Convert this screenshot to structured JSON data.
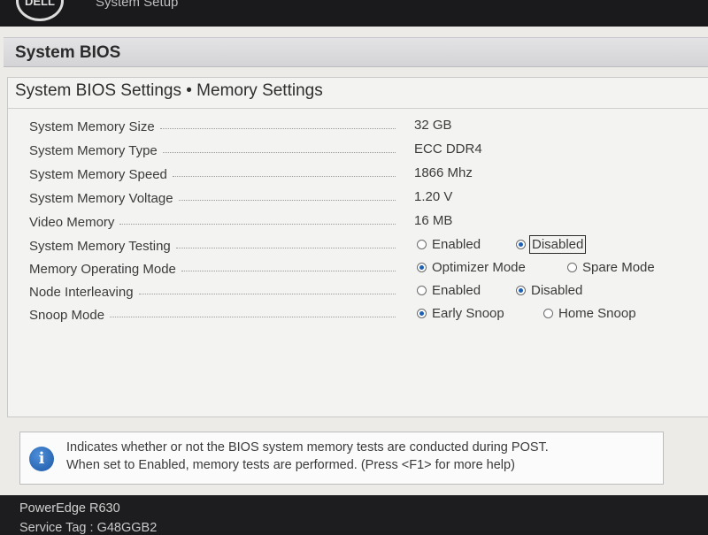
{
  "header": {
    "logo": "DELL",
    "title": "System Setup"
  },
  "main": {
    "title": "System BIOS"
  },
  "section": {
    "title": "System BIOS Settings • Memory Settings"
  },
  "info_rows": [
    {
      "label": "System Memory Size",
      "value": "32 GB"
    },
    {
      "label": "System Memory Type",
      "value": "ECC DDR4"
    },
    {
      "label": "System Memory Speed",
      "value": "1866 Mhz"
    },
    {
      "label": "System Memory Voltage",
      "value": "1.20 V"
    },
    {
      "label": "Video Memory",
      "value": "16 MB"
    }
  ],
  "option_rows": [
    {
      "label": "System Memory Testing",
      "options": [
        {
          "label": "Enabled",
          "selected": false
        },
        {
          "label": "Disabled",
          "selected": true
        }
      ]
    },
    {
      "label": "Memory Operating Mode",
      "options": [
        {
          "label": "Optimizer Mode",
          "selected": true
        },
        {
          "label": "Spare Mode",
          "selected": false
        }
      ]
    },
    {
      "label": "Node Interleaving",
      "options": [
        {
          "label": "Enabled",
          "selected": false
        },
        {
          "label": "Disabled",
          "selected": true
        }
      ]
    },
    {
      "label": "Snoop Mode",
      "options": [
        {
          "label": "Early Snoop",
          "selected": true
        },
        {
          "label": "Home Snoop",
          "selected": false
        }
      ]
    }
  ],
  "help": {
    "icon": "info-icon",
    "line1": "Indicates whether or not the BIOS system memory tests are conducted during POST.",
    "line2": "When set to Enabled, memory tests are performed. (Press <F1> for more help)"
  },
  "footer": {
    "model": "PowerEdge R630",
    "service_tag": "Service Tag : G48GGB2"
  },
  "colors": {
    "radio_selected": "#1e5fb0",
    "panel_bg": "#ecebe7",
    "frame_bg": "#1b1b1d",
    "info_icon": "#1c57a5"
  }
}
